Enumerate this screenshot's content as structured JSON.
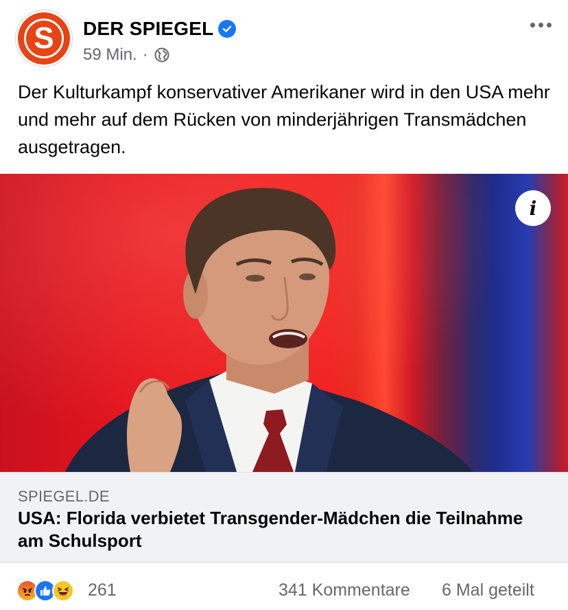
{
  "post": {
    "avatar_letter": "S",
    "page_name": "DER SPIEGEL",
    "time": "59 Min.",
    "separator": "·",
    "audience_icon": "globe-icon",
    "verified_icon": "verified-badge-icon",
    "more_icon": "more-options-icon",
    "text": "Der Kulturkampf konservativer Amerikaner wird in den USA mehr und mehr auf dem Rücken von minderjährigen Transmädchen ausgetragen."
  },
  "image": {
    "info_label": "i"
  },
  "link": {
    "domain": "SPIEGEL.DE",
    "title": "USA: Florida verbietet Transgender-Mädchen die Teilnahme am Schulsport"
  },
  "stats": {
    "reaction_icons": [
      "angry-reaction-icon",
      "like-reaction-icon",
      "haha-reaction-icon"
    ],
    "reaction_count": "261",
    "comments": "341 Kommentare",
    "shares": "6 Mal geteilt"
  },
  "colors": {
    "brand_orange": "#e64415",
    "facebook_blue": "#1877f2",
    "secondary_text": "#65676b",
    "card_background": "#f0f2f5"
  }
}
